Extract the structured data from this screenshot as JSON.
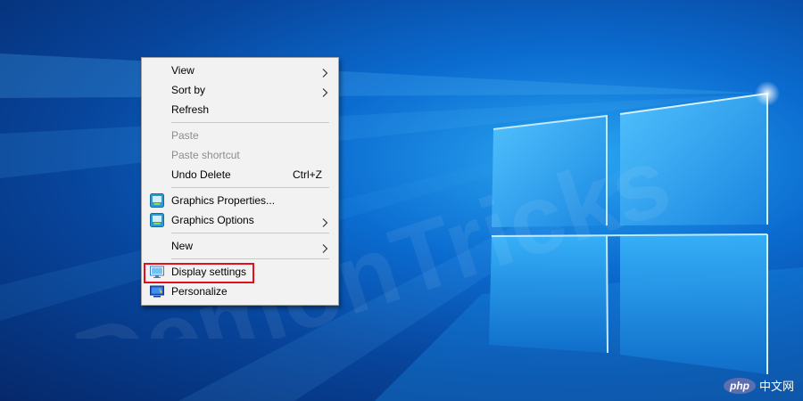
{
  "menu": {
    "groups": [
      [
        {
          "label": "View",
          "submenu": true
        },
        {
          "label": "Sort by",
          "submenu": true
        },
        {
          "label": "Refresh"
        }
      ],
      [
        {
          "label": "Paste",
          "disabled": true
        },
        {
          "label": "Paste shortcut",
          "disabled": true
        },
        {
          "label": "Undo Delete",
          "shortcut": "Ctrl+Z"
        }
      ],
      [
        {
          "label": "Graphics Properties...",
          "icon": "intel-graphics-icon"
        },
        {
          "label": "Graphics Options",
          "icon": "intel-graphics-icon",
          "submenu": true
        }
      ],
      [
        {
          "label": "New",
          "submenu": true
        }
      ],
      [
        {
          "label": "Display settings",
          "icon": "monitor-icon",
          "highlighted": true
        },
        {
          "label": "Personalize",
          "icon": "personalize-icon"
        }
      ]
    ]
  },
  "watermark": {
    "text": "DemonTricks"
  },
  "badge": {
    "logo": "php",
    "text": "中文网"
  },
  "colors": {
    "highlight_border": "#e3101b",
    "menu_bg": "#f2f2f2"
  }
}
